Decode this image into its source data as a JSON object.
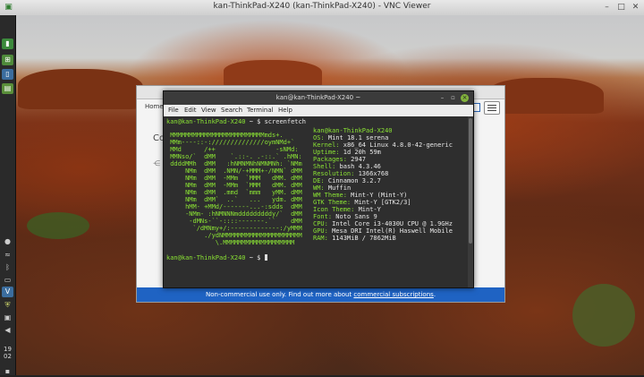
{
  "window": {
    "title": "kan-ThinkPad-X240 (kan-ThinkPad-X240) - VNC Viewer"
  },
  "panel": {
    "time_hour": "19",
    "time_min": "02"
  },
  "browser": {
    "home_label": "Home",
    "heading_partial": "Co",
    "footer_text": "Non-commercial use only. Find out more about ",
    "footer_link": "commercial subscriptions",
    "footer_end": "."
  },
  "terminal": {
    "title": "kan@kan-ThinkPad-X240 ~",
    "menu": [
      "File",
      "Edit",
      "View",
      "Search",
      "Terminal",
      "Help"
    ],
    "prompt": "kan@kan-ThinkPad-X240",
    "prompt_suffix": " ~ $ ",
    "command": "screenfetch",
    "user_host": "kan@kan-ThinkPad-X240",
    "ascii": [
      " MMMMMMMMMMMMMMMMMMMMMMMMMmds+.",
      " MMm----::-://////////////oymNMd+`",
      " MMd      /++                -sNMd:",
      " MMNso/`  dMM    `.::-. .-::.` .hMN:",
      " ddddMMh  dMM   :hNMNMNhNMNMNh: `NMm",
      "     NMm  dMM  .NMN/-+MMM+-/NMN` dMM",
      "     NMm  dMM  -MMm  `MMM   dMM. dMM",
      "     NMm  dMM  -MMm  `MMM   dMM. dMM",
      "     NMm  dMM  .mmd  `mmm   yMM. dMM",
      "     NMm  dMM`  ..`   ...   ydm. dMM",
      "     hMM- +MMd/-------...-:sdds  dMM",
      "     -NMm- :hNMNNNmdddddddddy/`  dMM",
      "      -dMNs-``-::::-------.``    dMM",
      "       `/dMNmy+/:-------------:/yMMM",
      "          ./ydNMMMMMMMMMMMMMMMMMMMMM",
      "             \\.MMMMMMMMMMMMMMMMMMM"
    ],
    "info": [
      {
        "key": "OS:",
        "value": "Mint 18.1 serena"
      },
      {
        "key": "Kernel:",
        "value": "x86_64 Linux 4.8.0-42-generic"
      },
      {
        "key": "Uptime:",
        "value": "1d 20h 59m"
      },
      {
        "key": "Packages:",
        "value": "2947"
      },
      {
        "key": "Shell:",
        "value": "bash 4.3.46"
      },
      {
        "key": "Resolution:",
        "value": "1366x768"
      },
      {
        "key": "DE:",
        "value": "Cinnamon 3.2.7"
      },
      {
        "key": "WM:",
        "value": "Muffin"
      },
      {
        "key": "WM Theme:",
        "value": "Mint-Y (Mint-Y)"
      },
      {
        "key": "GTK Theme:",
        "value": "Mint-Y [GTK2/3]"
      },
      {
        "key": "Icon Theme:",
        "value": "Mint-Y"
      },
      {
        "key": "Font:",
        "value": "Noto Sans 9"
      },
      {
        "key": "CPU:",
        "value": "Intel Core i3-4030U CPU @ 1.9GHz"
      },
      {
        "key": "GPU:",
        "value": "Mesa DRI Intel(R) Haswell Mobile"
      },
      {
        "key": "RAM:",
        "value": "1143MiB / 7862MiB"
      }
    ]
  },
  "colors": {
    "terminal_green": "#8ae234",
    "footer_blue": "#1f63c3",
    "panel": "#2a2a2a"
  }
}
